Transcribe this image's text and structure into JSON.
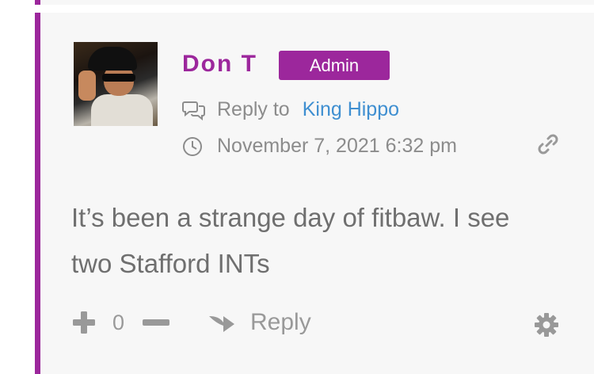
{
  "comment": {
    "author": "Don T",
    "badge": "Admin",
    "reply_to_label": "Reply to",
    "reply_to_user": "King Hippo",
    "timestamp": "November 7, 2021 6:32 pm",
    "text": "It’s been a strange day of fitbaw. I see two Stafford INTs",
    "vote_count": "0",
    "reply_label": "Reply"
  },
  "colors": {
    "accent": "#9c279c",
    "link": "#3f8fd1",
    "muted": "#8c8c8c"
  },
  "icons": [
    "chat-bubbles-icon",
    "clock-icon",
    "link-icon",
    "plus-icon",
    "minus-icon",
    "reply-arrow-icon",
    "gear-icon"
  ]
}
